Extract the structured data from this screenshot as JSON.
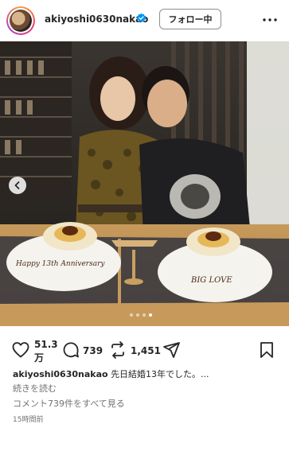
{
  "header": {
    "username": "akiyoshi0630nakao",
    "follow_label": "フォロー中"
  },
  "photo": {
    "plate_left_text": "Happy 13th Anniversary",
    "plate_right_text": "BIG LOVE",
    "carousel": {
      "dot_count": 4,
      "active_index": 3
    }
  },
  "actions": {
    "likes": "51.3",
    "likes_unit": "万",
    "comments": "739",
    "reposts": "1,451"
  },
  "caption": {
    "username": "akiyoshi0630nakao",
    "text": "先日結婚13年でした。...",
    "read_more": "続きを読む"
  },
  "comments_link": "コメント739件をすべて見る",
  "timestamp": "15時間前",
  "colors": {
    "verified_blue": "#0095f6",
    "text_primary": "#262626",
    "text_secondary": "#737373"
  },
  "icons": [
    "verified-badge-icon",
    "more-options-icon",
    "chevron-left-icon",
    "heart-icon",
    "comment-icon",
    "repost-icon",
    "share-icon",
    "bookmark-icon"
  ]
}
